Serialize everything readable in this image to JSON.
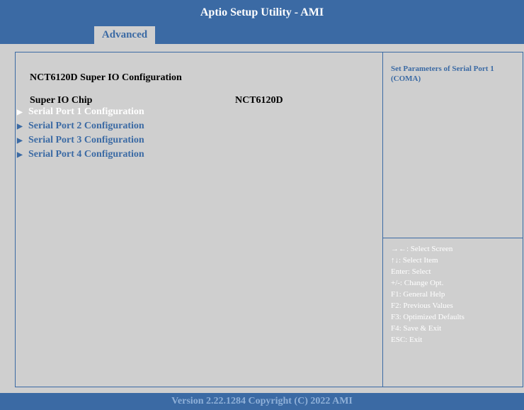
{
  "window": {
    "title": "Aptio Setup Utility - AMI"
  },
  "tabs": [
    {
      "label": "Advanced",
      "active": true
    }
  ],
  "main": {
    "section_title": "NCT6120D Super IO Configuration",
    "chip": {
      "label": "Super IO Chip",
      "value": "NCT6120D"
    },
    "menu_items": [
      {
        "label": "Serial Port 1 Configuration",
        "arrow": "▶",
        "selected": true
      },
      {
        "label": "Serial Port 2 Configuration",
        "arrow": "▶",
        "selected": false
      },
      {
        "label": "Serial Port 3 Configuration",
        "arrow": "▶",
        "selected": false
      },
      {
        "label": "Serial Port 4 Configuration",
        "arrow": "▶",
        "selected": false
      }
    ]
  },
  "help": {
    "description": "Set Parameters of Serial Port 1 (COMA)",
    "keys": [
      "→←: Select Screen",
      "↑↓: Select Item",
      "Enter: Select",
      "+/-: Change Opt.",
      "F1: General Help",
      "F2: Previous Values",
      "F3: Optimized Defaults",
      "F4: Save & Exit",
      "ESC: Exit"
    ]
  },
  "footer": {
    "text": "Version 2.22.1284 Copyright (C) 2022 AMI"
  },
  "colors": {
    "brand_blue": "#3b6aa4",
    "panel_gray": "#cfcfcf",
    "selected_text": "#ffffff"
  }
}
